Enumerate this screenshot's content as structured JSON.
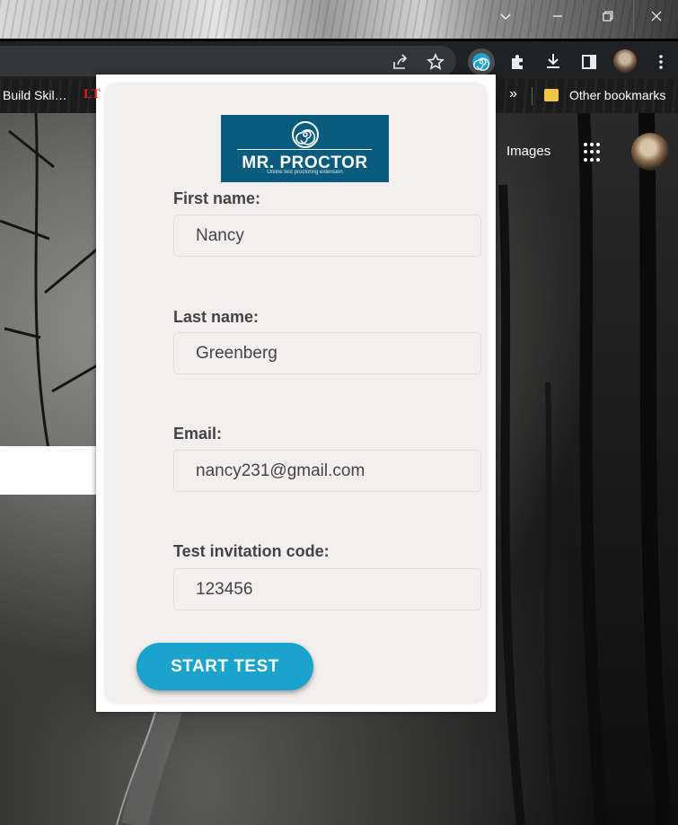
{
  "bookmarks": {
    "left_item": "Build Skil…",
    "left_icon_text": "LT",
    "overflow": "»",
    "other_bookmarks": "Other bookmarks"
  },
  "google": {
    "images_link": "Images"
  },
  "extension": {
    "logo_title": "MR. PROCTOR",
    "logo_subtitle": "Online test proctoring extension",
    "fields": [
      {
        "label": "First name:",
        "value": "Nancy"
      },
      {
        "label": "Last name:",
        "value": "Greenberg"
      },
      {
        "label": "Email:",
        "value": "nancy231@gmail.com"
      },
      {
        "label": "Test invitation code:",
        "value": "123456"
      }
    ],
    "start_button": "START TEST"
  },
  "colors": {
    "brand": "#0a5c7e",
    "button": "#1aa3cc",
    "card_bg": "#f3efef"
  },
  "icons": [
    "chevron-down-icon",
    "minimize-icon",
    "restore-icon",
    "close-icon",
    "share-icon",
    "star-icon",
    "mr-proctor-extension-icon",
    "puzzle-icon",
    "download-icon",
    "side-panel-icon",
    "profile-avatar",
    "kebab-menu-icon",
    "folder-icon",
    "apps-grid-icon"
  ]
}
